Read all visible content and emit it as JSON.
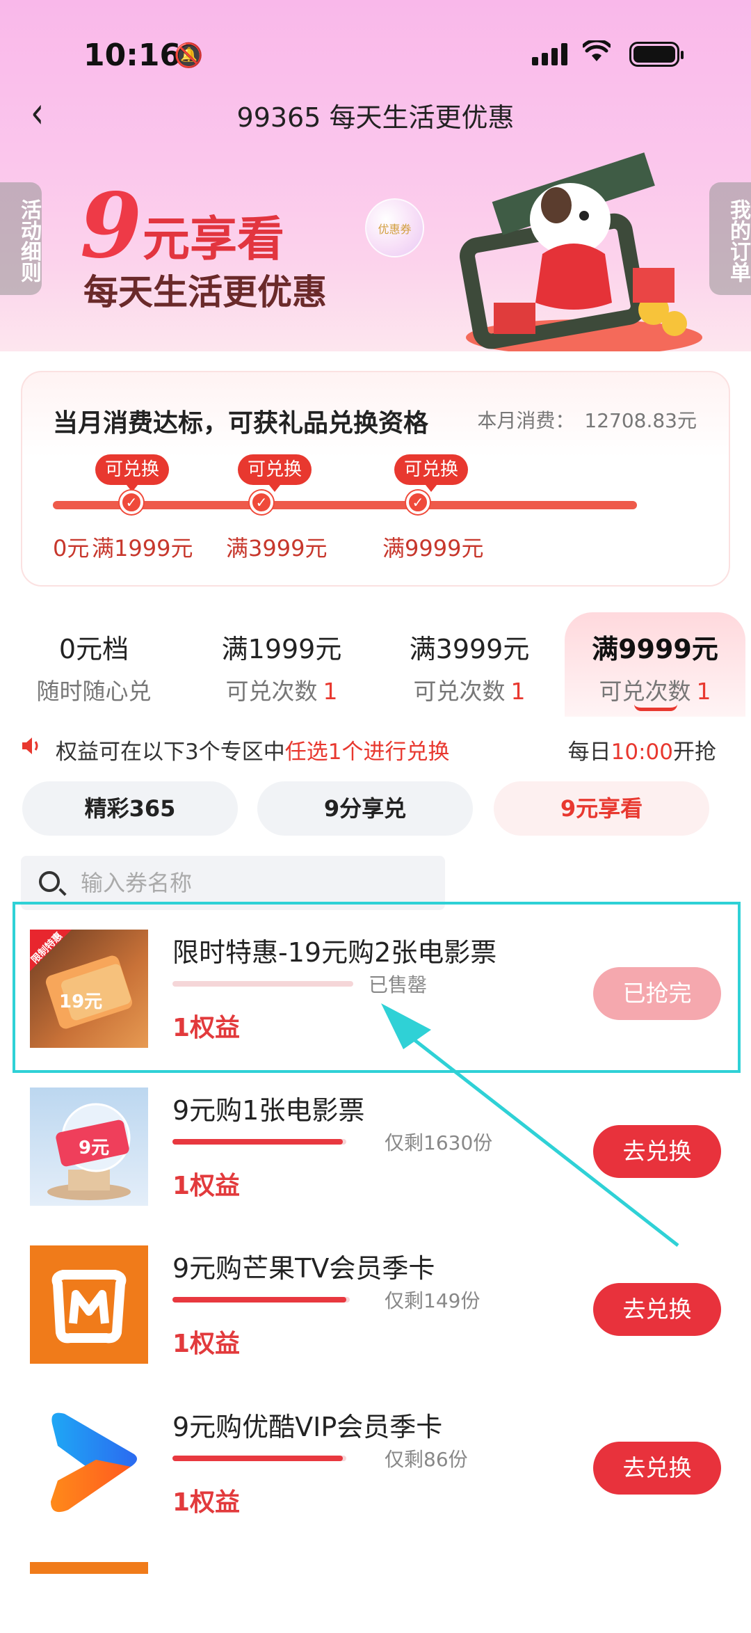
{
  "status_bar": {
    "time": "10:16"
  },
  "nav": {
    "title": "99365 每天生活更优惠"
  },
  "banner": {
    "left_tab": "活动细则",
    "right_tab": "我的订单",
    "nine": "9",
    "headline": "元享看",
    "subline": "每天生活更优惠",
    "coupon_text": "优惠券"
  },
  "progress": {
    "title": "当月消费达标，可获礼品兑换资格",
    "spend_label": "本月消费：",
    "spend_value": "12708.83元",
    "fill_fraction": 1.0,
    "badge": "可兑换",
    "labels": [
      "0元",
      "满1999元",
      "满3999元",
      "满9999元"
    ]
  },
  "tiers": [
    {
      "name": "0元档",
      "sub": "随时随心兑",
      "count": ""
    },
    {
      "name": "满1999元",
      "sub": "可兑次数",
      "count": "1"
    },
    {
      "name": "满3999元",
      "sub": "可兑次数",
      "count": "1"
    },
    {
      "name": "满9999元",
      "sub": "可兑次数",
      "count": "1"
    }
  ],
  "notice": {
    "prefix": "权益可在以下3个专区中",
    "highlight": "任选1个进行兑换",
    "right_prefix": "每日",
    "right_time": "10:00",
    "right_suffix": "开抢"
  },
  "zones": [
    "精彩365",
    "9分享兑",
    "9元享看"
  ],
  "search": {
    "placeholder": "输入券名称"
  },
  "items": [
    {
      "title": "限时特惠-19元购2张电影票",
      "stock": "已售罄",
      "progress": 0.0,
      "benefit": "1权益",
      "button": "已抢完",
      "corner_tag": "限制特惠",
      "thumb_text": "19元"
    },
    {
      "title": "9元购1张电影票",
      "stock": "仅剩1630份",
      "progress": 0.98,
      "benefit": "1权益",
      "button": "去兑换",
      "thumb_text": "9元"
    },
    {
      "title": "9元购芒果TV会员季卡",
      "stock": "仅剩149份",
      "progress": 0.98,
      "benefit": "1权益",
      "button": "去兑换"
    },
    {
      "title": "9元购优酷VIP会员季卡",
      "stock": "仅剩86份",
      "progress": 0.98,
      "benefit": "1权益",
      "button": "去兑换"
    }
  ],
  "colors": {
    "accent": "#e8382f",
    "highlight_box": "#2fd1d6",
    "banner_pink": "#f9b8ea"
  }
}
